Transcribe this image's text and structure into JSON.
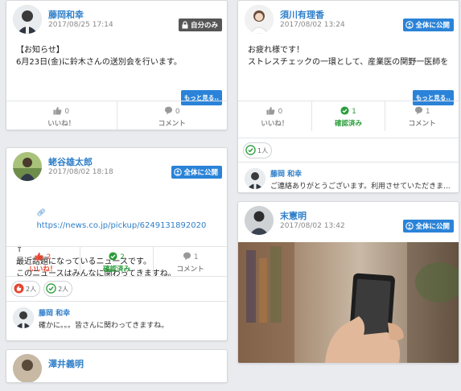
{
  "posts": [
    {
      "author": "藤岡和幸",
      "date": "2017/08/25 17:14",
      "visibility": "自分のみ",
      "body_lines": [
        "【お知らせ】",
        "",
        "6月23日(金)に鈴木さんの送別会を行います。"
      ],
      "more_label": "もっと見る..",
      "actions": {
        "like": {
          "count": "0",
          "label": "いいね！"
        },
        "comment": {
          "count": "0",
          "label": "コメント"
        }
      }
    },
    {
      "author": "須川有理香",
      "date": "2017/08/02 13:24",
      "visibility": "全体に公開",
      "body_lines": [
        "お疲れ様です！",
        "",
        "ストレスチェックの一環として、産業医の関野一医師を"
      ],
      "more_label": "もっと見る..",
      "actions": {
        "like": {
          "count": "0",
          "label": "いいね！"
        },
        "confirm": {
          "count": "1",
          "label": "確認済み"
        },
        "comment": {
          "count": "1",
          "label": "コメント"
        }
      },
      "reactions": [
        {
          "type": "confirm",
          "label": "1人"
        }
      ],
      "comment": {
        "author": "藤岡 和幸",
        "text": "ご連絡ありがとうございます。利用させていただきま..."
      }
    },
    {
      "author": "蛯谷雄太郎",
      "date": "2017/08/02 18:18",
      "visibility": "全体に公開",
      "link_text": "https://news.co.jp/pickup/6249131892020",
      "body_lines": [
        "↑",
        "最近話題になっているニュースです。",
        "このニュースはみんなに関わってきますね。"
      ],
      "actions": {
        "like": {
          "count": "2",
          "label": "いいね！"
        },
        "confirm": {
          "count": "2",
          "label": "確認済み"
        },
        "comment": {
          "count": "1",
          "label": "コメント"
        }
      },
      "reactions": [
        {
          "type": "like",
          "label": "2人"
        },
        {
          "type": "confirm",
          "label": "2人"
        }
      ],
      "comment": {
        "author": "藤岡 和幸",
        "text": "確かに。。。皆さんに関わってきますね。"
      }
    },
    {
      "author": "末憲明",
      "date": "2017/08/02 13:42",
      "visibility": "全体に公開"
    },
    {
      "author": "澤井義明"
    }
  ],
  "icons": {
    "lock": "lock-icon",
    "globe": "globe-icon",
    "thumb": "thumbs-up-icon",
    "check": "check-circle-icon",
    "bubble": "speech-bubble-icon"
  },
  "colors": {
    "accent": "#2a83d8",
    "like": "#e5452f",
    "confirm": "#2a9d3a",
    "muted": "#888888"
  }
}
